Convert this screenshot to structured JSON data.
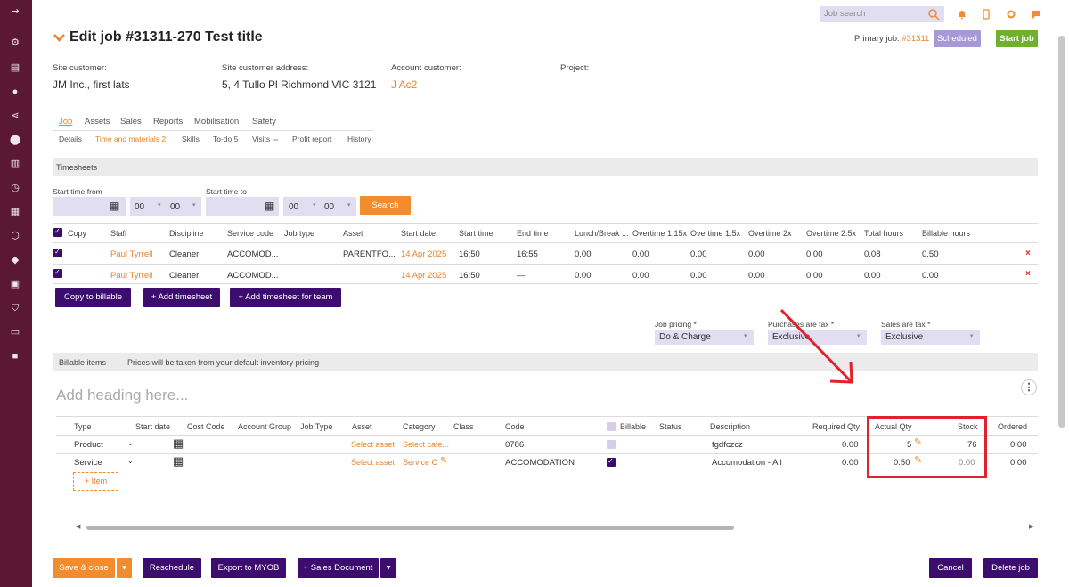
{
  "sidebar": {
    "icons": [
      "logout-icon",
      "dispatch-icon",
      "document-icon",
      "user-icon",
      "share-icon",
      "location-icon",
      "chart-icon",
      "clock-icon",
      "clipboard-icon",
      "box-icon",
      "tag-icon",
      "scan-icon",
      "shield-icon",
      "book-icon",
      "notebook-icon"
    ]
  },
  "top": {
    "search_placeholder": "Job search"
  },
  "header": {
    "title": "Edit job #31311-270 Test title",
    "primary_label": "Primary job:",
    "primary_link": "#31311",
    "status": "Scheduled",
    "start_job": "Start job"
  },
  "info": {
    "site_customer_label": "Site customer:",
    "site_customer_value": "JM Inc., first lats",
    "site_address_label": "Site customer address:",
    "site_address_value": "5, 4 Tullo Pl Richmond VIC 3121",
    "account_customer_label": "Account customer:",
    "account_customer_value": "J Ac2",
    "project_label": "Project:"
  },
  "tabs_main": [
    "Job",
    "Assets",
    "Sales",
    "Reports",
    "Mobilisation",
    "Safety"
  ],
  "tabs_sub": [
    "Details",
    "Time and materials 2",
    "Skills",
    "To-do 5",
    "Visits ⇔",
    "Profit report",
    "History"
  ],
  "timesheets": {
    "section_title": "Timesheets",
    "start_from_label": "Start time from",
    "start_to_label": "Start time to",
    "hh1": "00",
    "mm1": "00",
    "hh2": "00",
    "mm2": "00",
    "search_btn": "Search",
    "headers": [
      "Copy",
      "Staff",
      "Discipline",
      "Service code",
      "Job type",
      "Asset",
      "Start date",
      "Start time",
      "End time",
      "Lunch/Break ...",
      "Overtime 1.15x",
      "Overtime 1.5x",
      "Overtime 2x",
      "Overtime 2.5x",
      "Total hours",
      "Billable hours"
    ],
    "rows": [
      {
        "staff": "Paul Tyrrell",
        "discipline": "Cleaner",
        "service": "ACCOMOD...",
        "jobtype": "",
        "asset": "PARENTFO...",
        "start_date": "14 Apr 2025",
        "start_time": "16:50",
        "end_time": "16:55",
        "lunch": "0.00",
        "ot115": "0.00",
        "ot15": "0.00",
        "ot2": "0.00",
        "ot25": "0.00",
        "total": "0.08",
        "billable": "0.50"
      },
      {
        "staff": "Paul Tyrrell",
        "discipline": "Cleaner",
        "service": "ACCOMOD...",
        "jobtype": "",
        "asset": "",
        "start_date": "14 Apr 2025",
        "start_time": "16:50",
        "end_time": "—",
        "lunch": "0.00",
        "ot115": "0.00",
        "ot15": "0.00",
        "ot2": "0.00",
        "ot25": "0.00",
        "total": "0.00",
        "billable": "0.00"
      }
    ],
    "btn_copy": "Copy to billable",
    "btn_add": "+ Add timesheet",
    "btn_add_team": "+ Add timesheet for team"
  },
  "pricing": {
    "job_pricing_label": "Job pricing *",
    "job_pricing_value": "Do & Charge",
    "purchases_label": "Purchases are tax *",
    "purchases_value": "Exclusive",
    "sales_label": "Sales are tax *",
    "sales_value": "Exclusive"
  },
  "billable": {
    "section_title": "Billable items",
    "note": "Prices will be taken from your default inventory pricing",
    "heading_placeholder": "Add heading here...",
    "headers": [
      "Type",
      "Start date",
      "Cost Code",
      "Account Group",
      "Job Type",
      "Asset",
      "Category",
      "Class",
      "Code",
      "Billable",
      "Status",
      "Description",
      "Required Qty",
      "Actual Qty",
      "Stock",
      "Ordered"
    ],
    "rows": [
      {
        "type": "Product",
        "asset": "Select asset",
        "category": "Select cate...",
        "code": "0786",
        "description": "fgdfczcz",
        "required": "0.00",
        "actual": "5",
        "stock": "76",
        "ordered": "0.00"
      },
      {
        "type": "Service",
        "asset": "Select asset",
        "category": "Service C",
        "code": "ACCOMODATION",
        "description": "Accomodation - All",
        "required": "0.00",
        "actual": "0.50",
        "stock": "0.00",
        "ordered": "0.00"
      }
    ],
    "add_item": "+ Item"
  },
  "footer": {
    "save_close": "Save & close",
    "reschedule": "Reschedule",
    "export": "Export to MYOB",
    "sales_doc": "+ Sales Document",
    "cancel": "Cancel",
    "delete": "Delete job"
  },
  "colors": {
    "sidebar": "#5a1834",
    "purple": "#3c0d6e",
    "orange": "#f28c2e",
    "annotation": "#e0232b"
  }
}
